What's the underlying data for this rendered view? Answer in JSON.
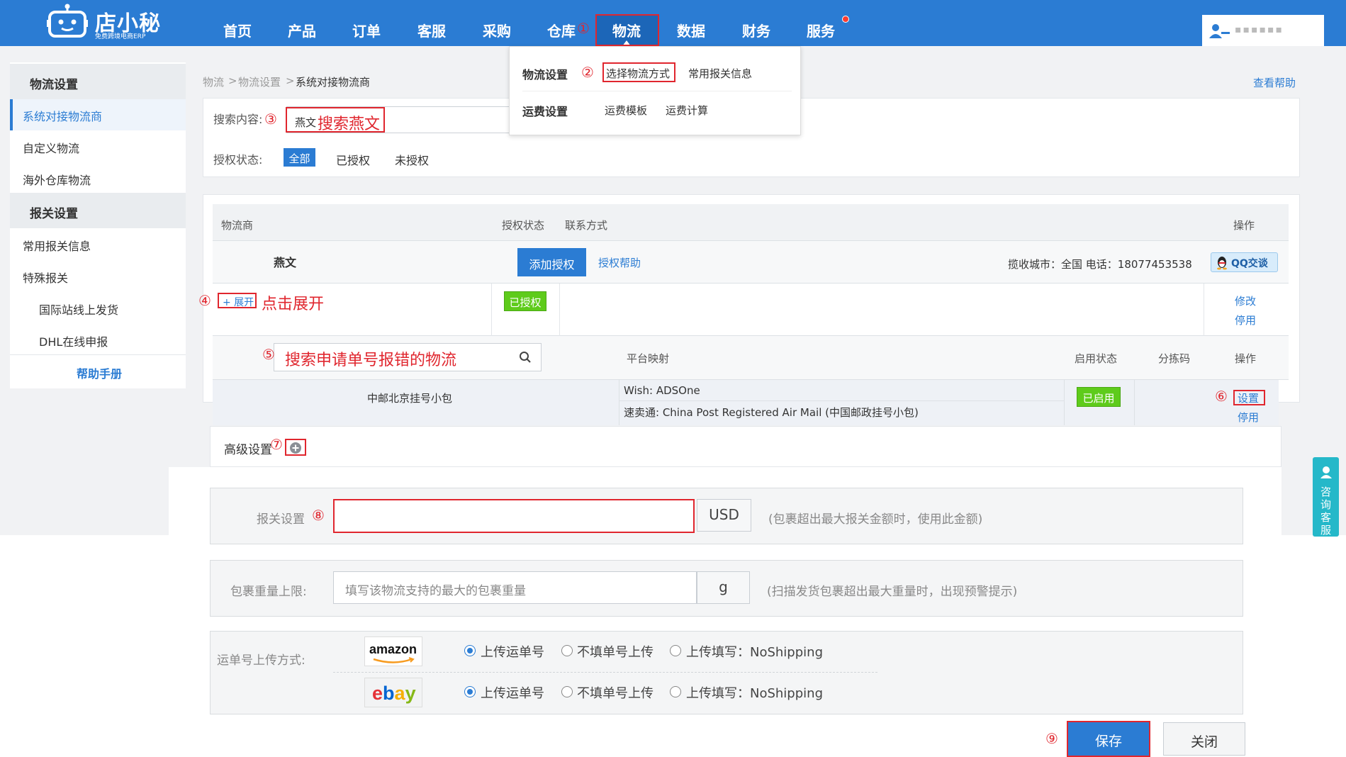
{
  "brand": {
    "name": "店小秘",
    "subtitle": "免费跨境电商ERP"
  },
  "nav": {
    "items": [
      "首页",
      "产品",
      "订单",
      "客服",
      "采购",
      "仓库",
      "物流",
      "数据",
      "财务",
      "服务"
    ],
    "active": "物流"
  },
  "user": {
    "name": "▪▪▪▪▪▪"
  },
  "dropdown": {
    "group1_title": "物流设置",
    "group1_items": [
      "选择物流方式",
      "常用报关信息"
    ],
    "group2_title": "运费设置",
    "group2_items": [
      "运费模板",
      "运费计算"
    ]
  },
  "sidebar": {
    "section1": "物流设置",
    "items1": [
      "系统对接物流商",
      "自定义物流",
      "海外仓库物流"
    ],
    "section2": "报关设置",
    "items2": [
      "常用报关信息",
      "特殊报关"
    ],
    "subitems": [
      "国际站线上发货",
      "DHL在线申报"
    ],
    "help": "帮助手册"
  },
  "breadcrumb": {
    "l1": "物流",
    "l2": "物流设置",
    "l3": "系统对接物流商",
    "sep": ">"
  },
  "help_link": "查看帮助",
  "filter": {
    "search_label": "搜索内容:",
    "search_value": "燕文",
    "status_label": "授权状态:",
    "status_options": [
      "全部",
      "已授权",
      "未授权"
    ]
  },
  "table": {
    "headers": {
      "carrier": "物流商",
      "auth": "授权状态",
      "contact": "联系方式",
      "ops": "操作"
    },
    "carrier_name": "燕文",
    "add_auth": "添加授权",
    "auth_help": "授权帮助",
    "contact_info": "揽收城市：全国   电话：18077453538",
    "qq_label": "QQ交谈",
    "expand_label": "+ 展开",
    "authorized_badge": "已授权",
    "modify": "修改",
    "disable": "停用"
  },
  "subtable": {
    "search_placeholder": "搜索申请单号报错的物流",
    "headers": {
      "mapping": "平台映射",
      "enable": "启用状态",
      "sort": "分拣码",
      "ops": "操作"
    },
    "service_name": "中邮北京挂号小包",
    "mapping1": "Wish:  ADSOne",
    "mapping2": "速卖通:   China Post Registered Air Mail (中国邮政挂号小包)",
    "enabled_badge": "已启用",
    "set_link": "设置",
    "disable_link": "停用"
  },
  "advanced": {
    "label": "高级设置"
  },
  "form": {
    "customs_label": "报关设置",
    "customs_unit": "USD",
    "customs_hint": "(包裹超出最大报关金额时，使用此金额)",
    "weight_label": "包裹重量上限:",
    "weight_placeholder": "填写该物流支持的最大的包裹重量",
    "weight_unit": "g",
    "weight_hint": "(扫描发货包裹超出最大重量时，出现预警提示)",
    "upload_label": "运单号上传方式:",
    "platforms": [
      "amazon",
      "ebay"
    ],
    "upload_options": [
      "上传运单号",
      "不填单号上传",
      "上传填写：NoShipping"
    ],
    "save": "保存",
    "close": "关闭"
  },
  "annotations": {
    "steps": [
      "①",
      "②",
      "③",
      "④",
      "⑤",
      "⑥",
      "⑦",
      "⑧",
      "⑨"
    ],
    "search_note": "搜索燕文",
    "expand_note": "点击展开",
    "sub_search_note": "搜索申请单号报错的物流"
  },
  "chat": {
    "label": "咨询客服"
  },
  "colors": {
    "primary": "#2b7cd3",
    "annotation": "#e0262e",
    "success": "#5ecb1b"
  }
}
